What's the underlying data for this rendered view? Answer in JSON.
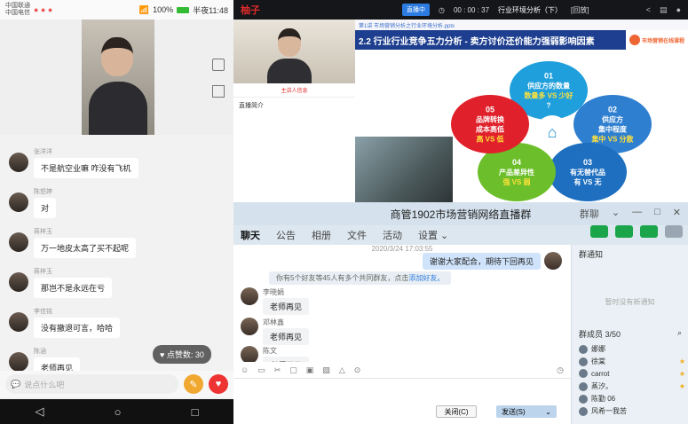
{
  "phone": {
    "status": {
      "carrier1": "中国联通",
      "carrier2": "中国电信",
      "right": "100%",
      "time": "半夜11:48"
    },
    "messages": [
      {
        "name": "张洋洋",
        "text": "不是航空业嘛 咋没有飞机"
      },
      {
        "name": "陈怒婷",
        "text": "对"
      },
      {
        "name": "蒋梓玉",
        "text": "万一地皮太高了买不起呢"
      },
      {
        "name": "蒋梓玉",
        "text": "那岂不是永远在亏"
      },
      {
        "name": "李佳铭",
        "text": "没有撤退可言，哈哈"
      },
      {
        "name": "陈涵",
        "text": "老师再见"
      }
    ],
    "likes": "点赞数: 30",
    "input_placeholder": "说点什么吧",
    "nav": {
      "back": "◁",
      "home": "○",
      "recent": "□"
    }
  },
  "pres": {
    "logo": "柚子",
    "live_badge": "直播中",
    "timer": "00 : 00 : 37",
    "title": "行业环境分析（下）",
    "title_tag": "[回放]",
    "host_label": "主讲人信息",
    "info": "直播简介",
    "file": "第1讲 市场营销分析之行业环境分析.pptx",
    "slide_title": "2.2 行业行业竞争五力分析 - 卖方讨价还价能力强弱影响因素",
    "brand": "市场营销在线课程",
    "petals": [
      {
        "num": "01",
        "l1": "供应方的数量",
        "l2": "数量多 VS 少好",
        "l3": "?",
        "color": "#1f9fdc"
      },
      {
        "num": "02",
        "l1": "供应方",
        "l2": "集中程度",
        "l3": "集中 VS 分散",
        "color": "#2f7fd0"
      },
      {
        "num": "03",
        "l1": "有无替代品",
        "l2": "有 VS 无",
        "l3": "",
        "color": "#1e6fc0"
      },
      {
        "num": "04",
        "l1": "产品差异性",
        "l2": "强 VS 弱",
        "l3": "",
        "color": "#6cbf2a"
      },
      {
        "num": "05",
        "l1": "品牌转换",
        "l2": "成本高低",
        "l3": "高 VS 低",
        "color": "#e0202a"
      }
    ]
  },
  "qq": {
    "title": "商管1902市场营销网络直播群",
    "title_tag": "群聊",
    "tabs": [
      "聊天",
      "公告",
      "相册",
      "文件",
      "活动",
      "设置 ⌄"
    ],
    "timestamp": "2020/3/24 17:03:55",
    "out_msg": "谢谢大家配合，期待下回再见",
    "sys_msg": "你有5个好友等45人有多个共同群友，点击",
    "sys_link": "添加好友。",
    "messages": [
      {
        "name": "李晓娟",
        "text": "老师再见"
      },
      {
        "name": "邓林鑫",
        "text": "老师再见"
      },
      {
        "name": "陈文",
        "text": "老师再见"
      }
    ],
    "close_btn": "关闭(C)",
    "send_btn": "发送(S)",
    "notice_title": "群通知",
    "notice_empty": "暂时没有新通知",
    "members_label": "群成员 3/50",
    "members": [
      {
        "name": "娜娜",
        "star": ""
      },
      {
        "name": "徐棠",
        "star": "★"
      },
      {
        "name": "carrot",
        "star": "★"
      },
      {
        "name": "蒸汐。",
        "star": "★"
      },
      {
        "name": "陈勤 06",
        "star": ""
      },
      {
        "name": "风希一我苦",
        "star": ""
      }
    ]
  }
}
